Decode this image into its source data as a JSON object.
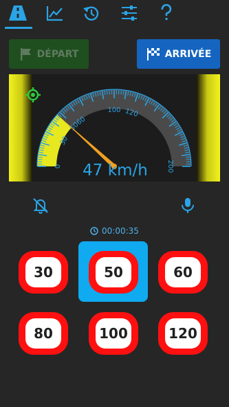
{
  "colors": {
    "background": "#262626",
    "accent": "#2aa4e6",
    "gauge_fill": "#e8e820",
    "needle": "#f0a020",
    "sign_red": "#ff1010",
    "selected": "#0faaf0",
    "start_button": "#1f4f1f",
    "finish_button": "#1565c0"
  },
  "tabs": [
    {
      "icon": "road-icon",
      "active": true
    },
    {
      "icon": "chart-icon",
      "active": false
    },
    {
      "icon": "history-icon",
      "active": false
    },
    {
      "icon": "settings-sliders-icon",
      "active": false
    },
    {
      "icon": "help-icon",
      "active": false
    }
  ],
  "buttons": {
    "depart_label": "DÉPART",
    "depart_icon": "flag-icon",
    "arrivee_label": "ARRIVÉE",
    "arrivee_icon": "checkered-flag-icon"
  },
  "gauge": {
    "current_speed": 47,
    "speed_text": "47 km/h",
    "min": 0,
    "max": 200,
    "tick_labels": [
      "0",
      "30",
      "50",
      "60",
      "100",
      "120",
      "200"
    ],
    "gps_icon": "gps-target-icon"
  },
  "controls": {
    "mute_icon": "bell-off-icon",
    "mic_icon": "microphone-icon"
  },
  "timer": {
    "icon": "clock-icon",
    "text": "00:00:35"
  },
  "speed_limits": [
    {
      "value": "30",
      "selected": false
    },
    {
      "value": "50",
      "selected": true
    },
    {
      "value": "60",
      "selected": false
    },
    {
      "value": "80",
      "selected": false
    },
    {
      "value": "100",
      "selected": false
    },
    {
      "value": "120",
      "selected": false
    }
  ]
}
